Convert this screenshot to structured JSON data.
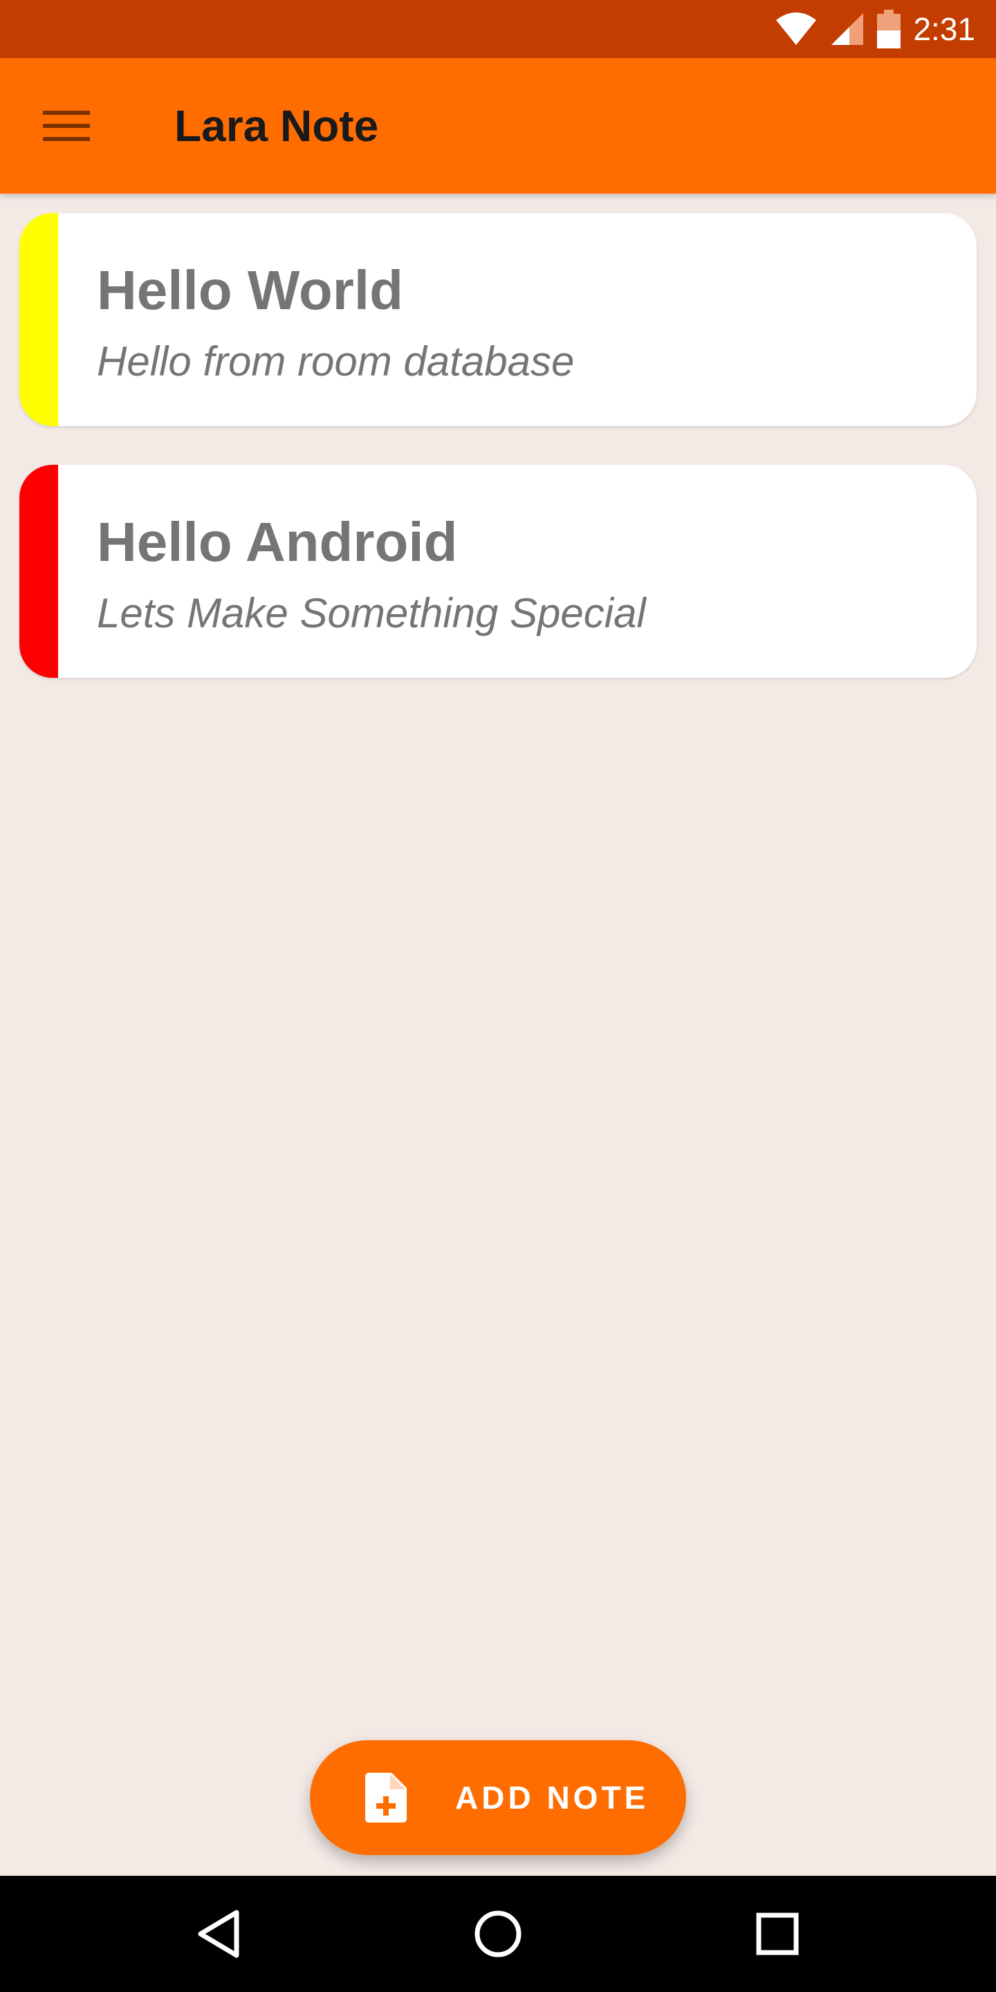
{
  "status_bar": {
    "time": "2:31",
    "icons": [
      "wifi-icon",
      "cell-signal-icon",
      "battery-icon"
    ],
    "color": "#C43D00"
  },
  "app_bar": {
    "title": "Lara Note",
    "menu_icon": "hamburger-menu-icon",
    "color": "#FF6D00"
  },
  "notes": [
    {
      "title": "Hello World",
      "subtitle": "Hello from room database",
      "color": "#FFFF00"
    },
    {
      "title": "Hello Android",
      "subtitle": "Lets Make Something Special",
      "color": "#FF0000"
    }
  ],
  "fab": {
    "label": "ADD NOTE",
    "icon": "add-note-icon",
    "color": "#FF6D00"
  },
  "nav_bar": {
    "items": [
      "back-icon",
      "home-icon",
      "recents-icon"
    ]
  }
}
